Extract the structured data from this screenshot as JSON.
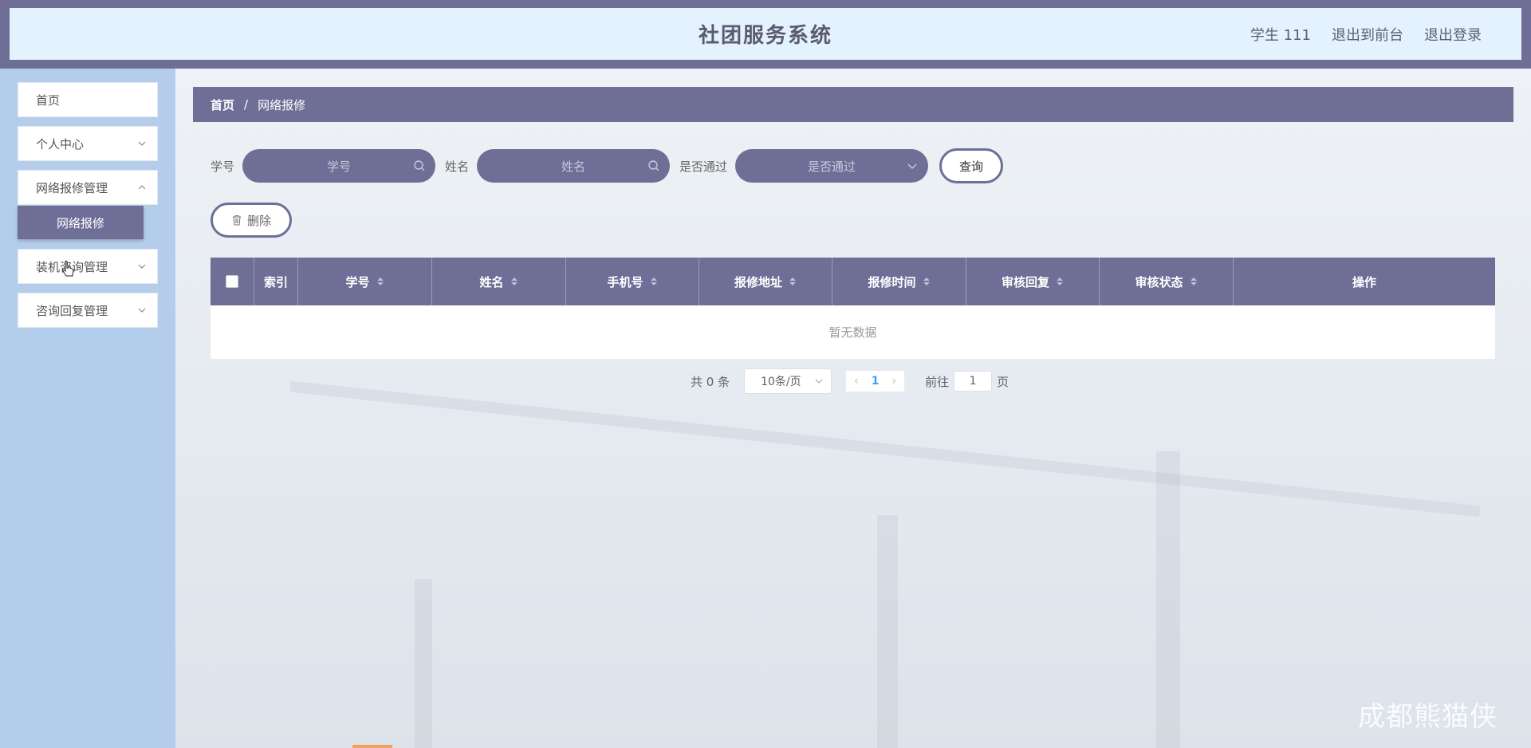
{
  "header": {
    "title": "社团服务系统",
    "user": "学生 111",
    "to_front": "退出到前台",
    "logout": "退出登录"
  },
  "sidebar": {
    "items": [
      {
        "label": "首页"
      },
      {
        "label": "个人中心"
      },
      {
        "label": "网络报修管理"
      },
      {
        "label": "装机咨询管理"
      },
      {
        "label": "咨询回复管理"
      }
    ],
    "submenu": {
      "label": "网络报修"
    }
  },
  "breadcrumb": {
    "home": "首页",
    "sep": "/",
    "current": "网络报修"
  },
  "search": {
    "student_no_label": "学号",
    "student_no_placeholder": "学号",
    "name_label": "姓名",
    "name_placeholder": "姓名",
    "passed_label": "是否通过",
    "passed_placeholder": "是否通过",
    "query_label": "查询"
  },
  "actions": {
    "delete_label": "删除"
  },
  "table": {
    "columns": [
      "索引",
      "学号",
      "姓名",
      "手机号",
      "报修地址",
      "报修时间",
      "审核回复",
      "审核状态",
      "操作"
    ],
    "empty_text": "暂无数据"
  },
  "pagination": {
    "total": "共 0 条",
    "page_size": "10条/页",
    "current_page": "1",
    "goto_prefix": "前往",
    "goto_value": "1",
    "goto_suffix": "页"
  },
  "watermark": "成都熊猫侠",
  "colors": {
    "primary": "#6e6e97",
    "header_bg": "#e3f2fc",
    "sidebar_bg": "#b3cdea"
  }
}
